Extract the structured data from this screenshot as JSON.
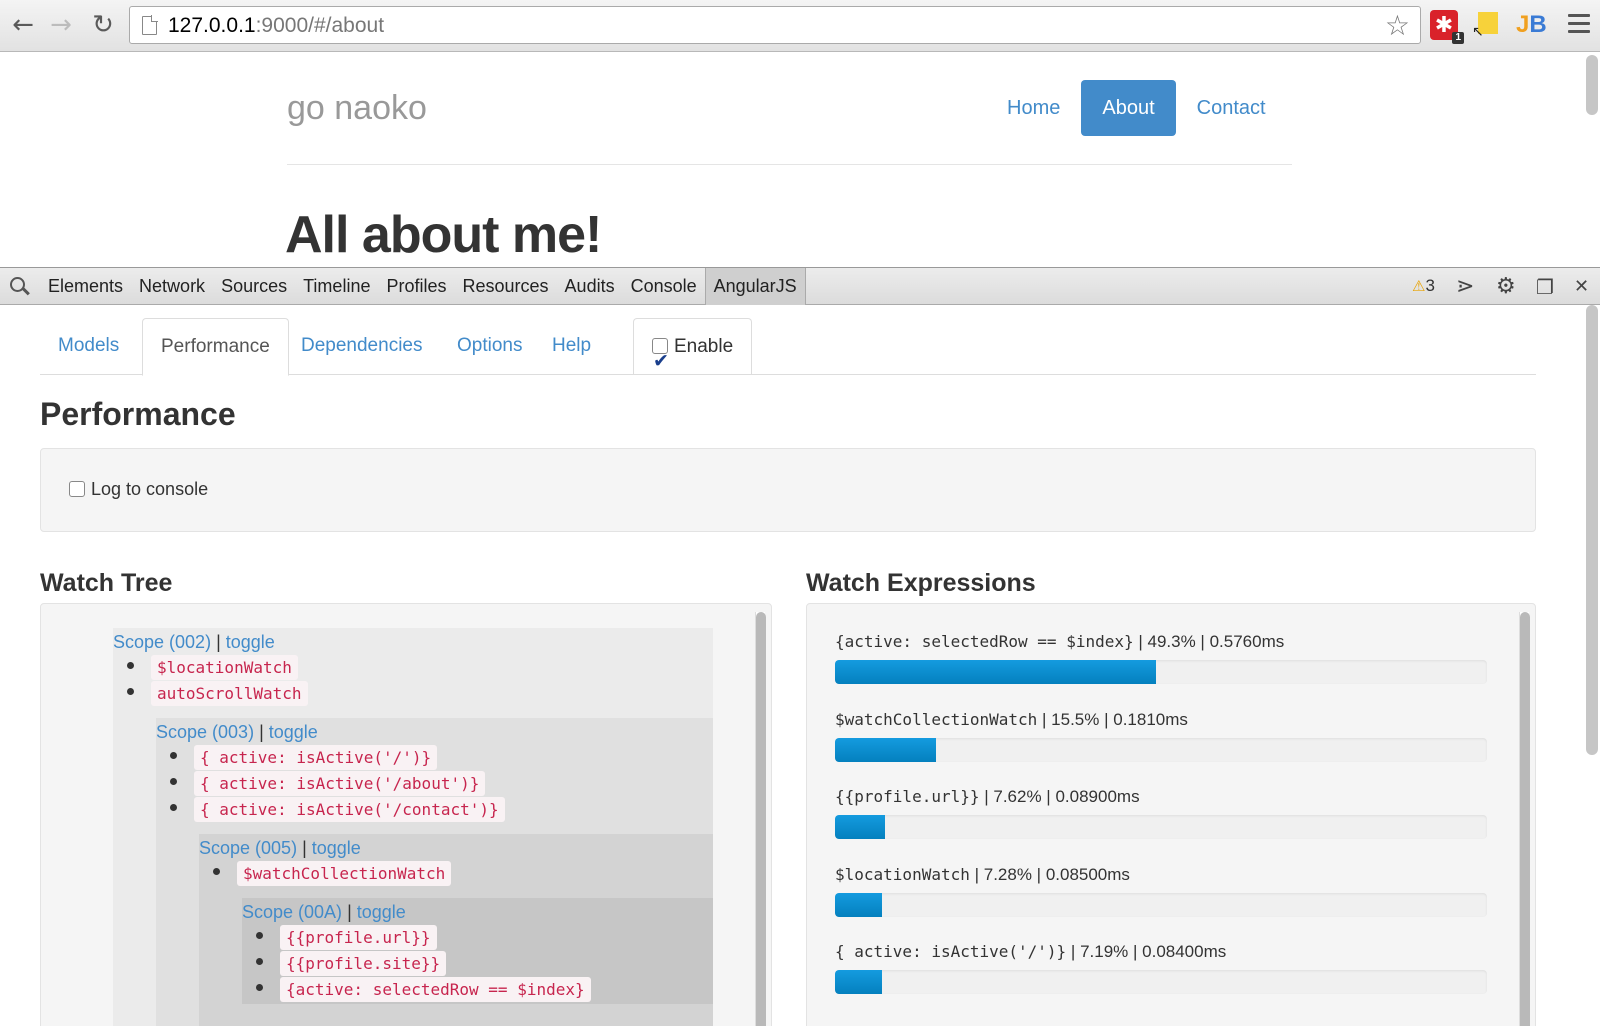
{
  "browser": {
    "url_host": "127.0.0.1",
    "url_rest": ":9000/#/about",
    "extensions": [
      {
        "name": "extension-red-icon",
        "badge": "1"
      },
      {
        "name": "extension-yellow-icon"
      },
      {
        "name": "jetbrains-icon",
        "label_j": "J",
        "label_b": "B"
      }
    ]
  },
  "site": {
    "brand": "go naoko",
    "nav": [
      {
        "label": "Home",
        "active": false
      },
      {
        "label": "About",
        "active": true
      },
      {
        "label": "Contact",
        "active": false
      }
    ],
    "heading": "All about me!"
  },
  "devtools": {
    "tabs": [
      "Elements",
      "Network",
      "Sources",
      "Timeline",
      "Profiles",
      "Resources",
      "Audits",
      "Console",
      "AngularJS"
    ],
    "active_tab": "AngularJS",
    "warning_count": "3"
  },
  "batarang": {
    "tabs": [
      "Models",
      "Performance",
      "Dependencies",
      "Options",
      "Help"
    ],
    "active_tab": "Performance",
    "enable_label": "Enable",
    "enable_checked": true,
    "section_title": "Performance",
    "log_label": "Log to console",
    "log_checked": false,
    "watch_tree_title": "Watch Tree",
    "watch_expr_title": "Watch Expressions",
    "toggle_label": "toggle",
    "scopes": [
      {
        "name": "Scope (002)",
        "watches": [
          "$locationWatch",
          "autoScrollWatch"
        ]
      },
      {
        "name": "Scope (003)",
        "watches": [
          "{ active: isActive('/')}",
          "{ active: isActive('/about')}",
          "{ active: isActive('/contact')}"
        ]
      },
      {
        "name": "Scope (005)",
        "watches": [
          "$watchCollectionWatch"
        ]
      },
      {
        "name": "Scope (00A)",
        "watches": [
          "{{profile.url}}",
          "{{profile.site}}",
          "{active: selectedRow == $index}"
        ]
      }
    ],
    "expressions": [
      {
        "expr": "{active: selectedRow == $index}",
        "percent": "49.3%",
        "time": "0.5760ms",
        "fraction": 0.493
      },
      {
        "expr": "$watchCollectionWatch",
        "percent": "15.5%",
        "time": "0.1810ms",
        "fraction": 0.155
      },
      {
        "expr": "{{profile.url}}",
        "percent": "7.62%",
        "time": "0.08900ms",
        "fraction": 0.0762
      },
      {
        "expr": "$locationWatch",
        "percent": "7.28%",
        "time": "0.08500ms",
        "fraction": 0.0728
      },
      {
        "expr": "{ active: isActive('/')}",
        "percent": "7.19%",
        "time": "0.08400ms",
        "fraction": 0.0719
      }
    ]
  }
}
